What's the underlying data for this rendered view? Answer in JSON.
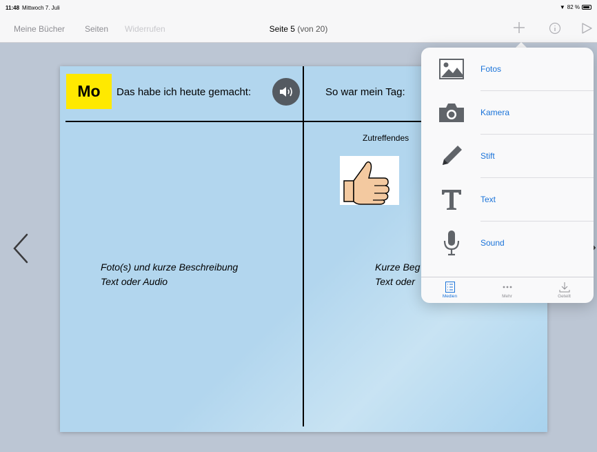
{
  "status": {
    "time": "11:48",
    "date": "Mittwoch 7. Juli",
    "battery": "82 %"
  },
  "nav": {
    "my_books": "Meine Bücher",
    "pages": "Seiten",
    "undo": "Widerrufen",
    "title": "Seite 5",
    "title_sub": "(von 20)",
    "icons": [
      "plus-icon",
      "info-icon",
      "play-icon"
    ]
  },
  "page": {
    "badge": "Mo",
    "heading_left": "Das habe ich heute gemacht:",
    "heading_right": "So war mein Tag:",
    "zutreffend": "Zutreffendes",
    "desc_left": [
      "Foto(s) und kurze Beschreibung",
      "Text oder Audio"
    ],
    "desc_right": [
      "Kurze Beg",
      "Text oder"
    ],
    "colors": {
      "background": "#b2d6ee",
      "badge": "#ffe900"
    }
  },
  "popover": {
    "items": [
      {
        "label": "Fotos",
        "icon": "photo-icon"
      },
      {
        "label": "Kamera",
        "icon": "camera-icon"
      },
      {
        "label": "Stift",
        "icon": "pencil-icon"
      },
      {
        "label": "Text",
        "icon": "text-icon"
      },
      {
        "label": "Sound",
        "icon": "microphone-icon"
      }
    ],
    "tabs": [
      {
        "label": "Medien",
        "icon": "list-icon",
        "active": true
      },
      {
        "label": "Mehr",
        "icon": "more-icon",
        "active": false
      },
      {
        "label": "Geteilt",
        "icon": "download-icon",
        "active": false
      }
    ],
    "accent": "#1a73d9"
  }
}
